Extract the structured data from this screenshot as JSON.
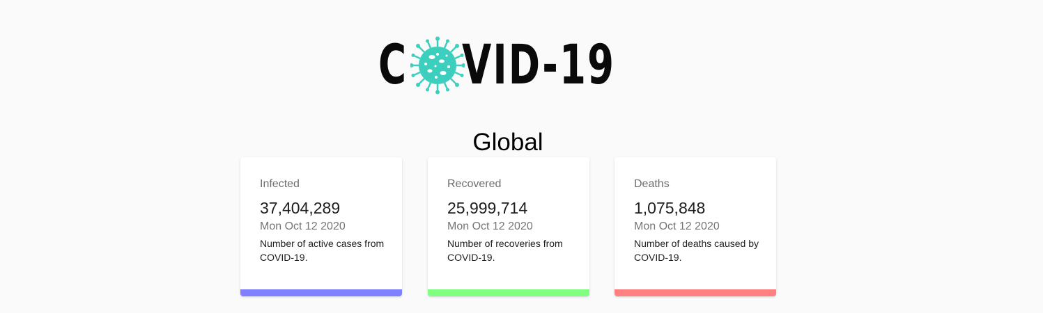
{
  "header": {
    "logo_letter_c": "C",
    "logo_rest": "VID-19",
    "logo_icon": "coronavirus-icon",
    "logo_icon_color": "#3dcfbe"
  },
  "region": {
    "title": "Global"
  },
  "cards": {
    "infected": {
      "title": "Infected",
      "value": "37,404,289",
      "date": "Mon Oct 12 2020",
      "description": "Number of active cases from COVID-19.",
      "color": "#8080ff"
    },
    "recovered": {
      "title": "Recovered",
      "value": "25,999,714",
      "date": "Mon Oct 12 2020",
      "description": "Number of recoveries from COVID-19.",
      "color": "#80ff80"
    },
    "deaths": {
      "title": "Deaths",
      "value": "1,075,848",
      "date": "Mon Oct 12 2020",
      "description": "Number of deaths caused by COVID-19.",
      "color": "#ff8080"
    }
  }
}
